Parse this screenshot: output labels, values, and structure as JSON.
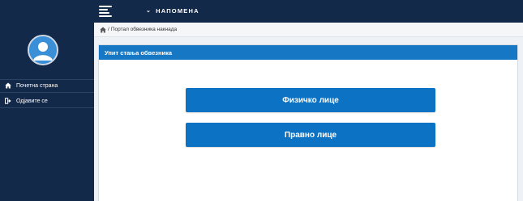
{
  "topbar": {
    "menu_label": "НАПОМЕНА"
  },
  "sidebar": {
    "items": [
      {
        "label": "Почетна страна",
        "icon": "home-icon"
      },
      {
        "label": "Одјавите се",
        "icon": "logout-icon"
      }
    ]
  },
  "breadcrumb": {
    "separator": "/",
    "current": "Портал обвезника накнада"
  },
  "panel": {
    "title": "Упит стања обвезника",
    "buttons": [
      {
        "label": "Физичко лице"
      },
      {
        "label": "Правно лице"
      }
    ]
  },
  "colors": {
    "navy": "#13294a",
    "accent_blue": "#1677c4",
    "button_blue": "#0b72c4"
  }
}
